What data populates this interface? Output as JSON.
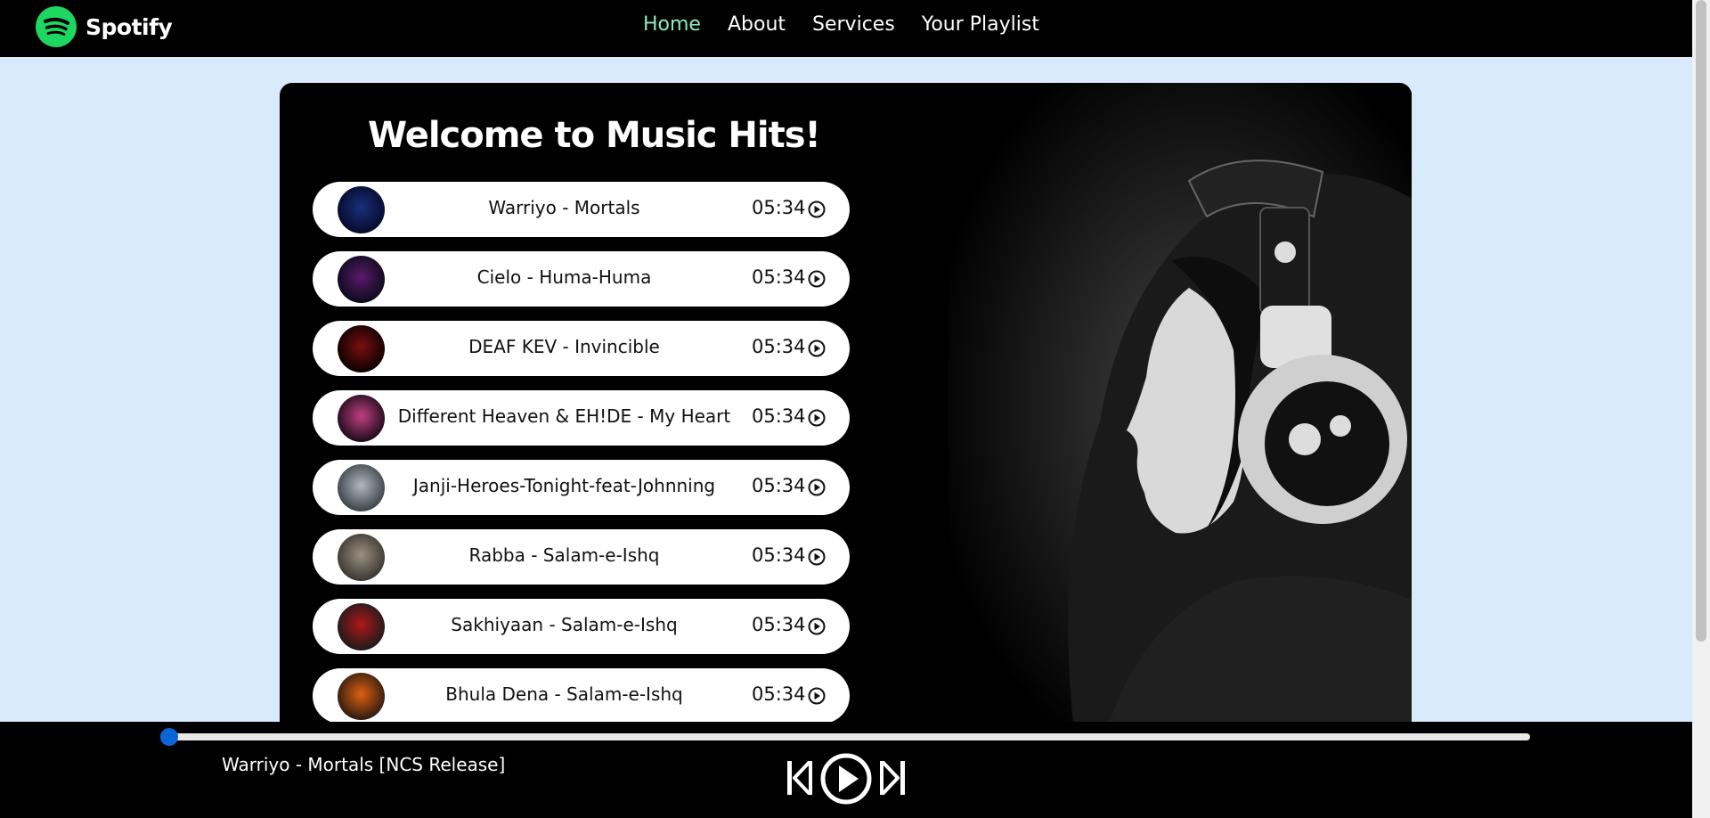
{
  "brand": {
    "name": "Spotify",
    "color": "#1ed760"
  },
  "nav": {
    "items": [
      {
        "label": "Home",
        "active": true
      },
      {
        "label": "About",
        "active": false
      },
      {
        "label": "Services",
        "active": false
      },
      {
        "label": "Your Playlist",
        "active": false
      }
    ],
    "active_color": "#8ce8c8"
  },
  "main": {
    "welcome_title": "Welcome to Music Hits!",
    "hero_image": "woman-with-headphones-photo",
    "songs": [
      {
        "title": "Warriyo - Mortals",
        "duration": "05:34",
        "cover": "cover-1",
        "cover_colors": [
          "#1a2f7a",
          "#050a2a"
        ]
      },
      {
        "title": "Cielo - Huma-Huma",
        "duration": "05:34",
        "cover": "cover-2",
        "cover_colors": [
          "#5a1a6a",
          "#0a0a1a"
        ]
      },
      {
        "title": "DEAF KEV - Invincible",
        "duration": "05:34",
        "cover": "cover-3",
        "cover_colors": [
          "#7a1010",
          "#0a0000"
        ]
      },
      {
        "title": "Different Heaven & EH!DE - My Heart",
        "duration": "05:34",
        "cover": "cover-4",
        "cover_colors": [
          "#c04080",
          "#1a0a1a"
        ]
      },
      {
        "title": "Janji-Heroes-Tonight-feat-Johnning",
        "duration": "05:34",
        "cover": "cover-5",
        "cover_colors": [
          "#b0b8c0",
          "#3a4048"
        ]
      },
      {
        "title": "Rabba - Salam-e-Ishq",
        "duration": "05:34",
        "cover": "cover-6",
        "cover_colors": [
          "#9a9080",
          "#3a3530"
        ]
      },
      {
        "title": "Sakhiyaan - Salam-e-Ishq",
        "duration": "05:34",
        "cover": "cover-7",
        "cover_colors": [
          "#b01818",
          "#1a1a1a"
        ]
      },
      {
        "title": "Bhula Dena - Salam-e-Ishq",
        "duration": "05:34",
        "cover": "cover-8",
        "cover_colors": [
          "#e06010",
          "#2a1a10"
        ]
      }
    ]
  },
  "player": {
    "now_playing": "Warriyo - Mortals [NCS Release]",
    "progress_fraction": 0.0,
    "accent": "#0a66d8",
    "controls": [
      "previous-icon",
      "play-icon",
      "next-icon"
    ]
  }
}
